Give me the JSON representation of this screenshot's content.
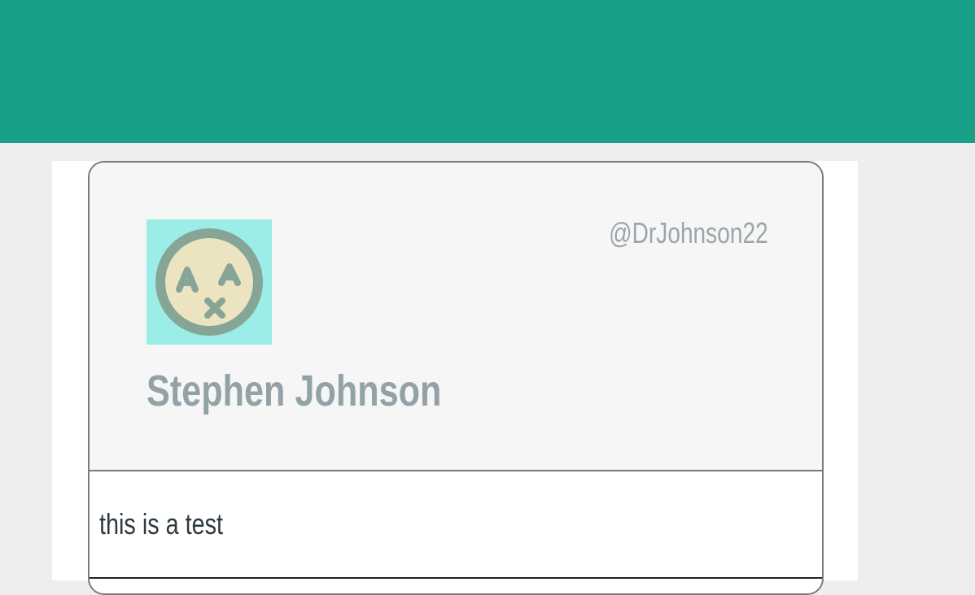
{
  "profile": {
    "handle": "@DrJohnson22",
    "display_name": "Stephen Johnson",
    "avatar_icon": "face-avatar-icon"
  },
  "tweet": {
    "text": "this is a test"
  },
  "colors": {
    "banner": "#189f87",
    "page_background": "#eeeeee",
    "card_header_background": "#f6f6f6",
    "avatar_background": "#9aeee7",
    "name_color": "#93a2a6",
    "handle_color": "#9aa6aa",
    "body_text_color": "#2e3a40"
  }
}
